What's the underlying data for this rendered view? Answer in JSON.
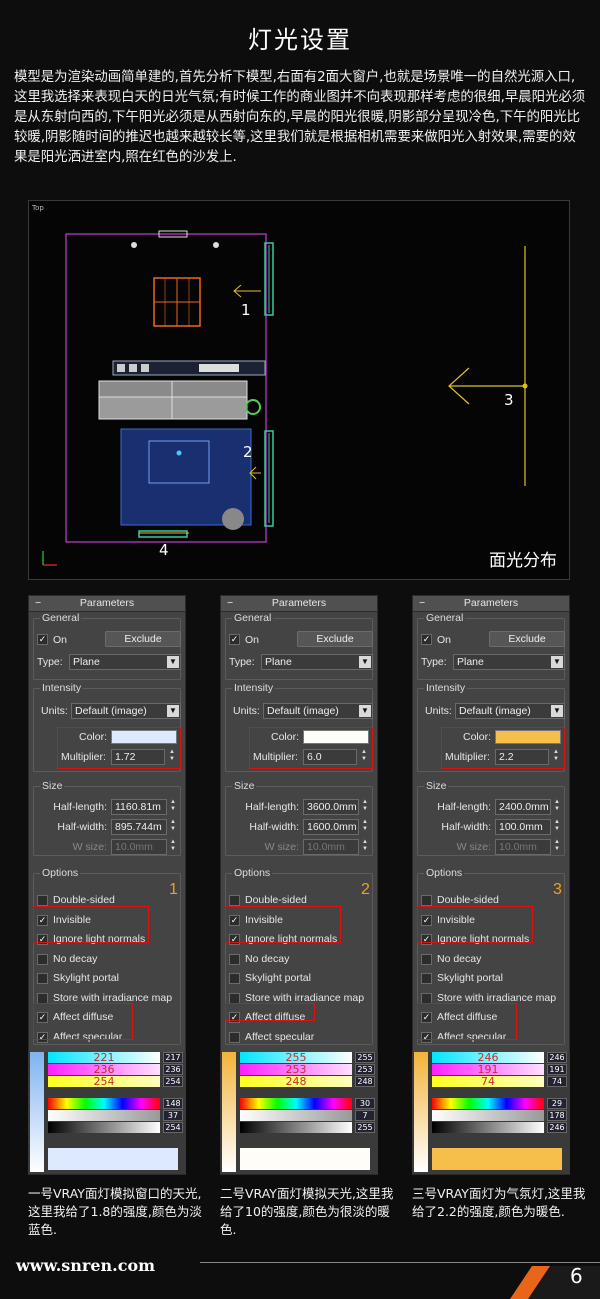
{
  "title": "灯光设置",
  "intro": "模型是为渲染动画简单建的,首先分析下模型,右面有2面大窗户,也就是场景唯一的自然光源入口,这里我选择来表现白天的日光气氛;有时候工作的商业图并不向表现那样考虑的很细,早晨阳光必须是从东射向西的,下午阳光必须是从西射向东的,早晨的阳光很暖,阴影部分呈现冷色,下午的阳光比较暖,阴影随时间的推迟也越来越较长等,这里我们就是根据相机需要来做阳光入射效果,需要的效果是阳光洒进室内,照在红色的沙发上.",
  "viewport": {
    "label": "Top",
    "caption": "面光分布",
    "markers": [
      "1",
      "2",
      "3",
      "4"
    ]
  },
  "panels": [
    {
      "header": "Parameters",
      "general_label": "General",
      "on_label": "On",
      "exclude_label": "Exclude",
      "type_label": "Type:",
      "type_value": "Plane",
      "intensity_label": "Intensity",
      "units_label": "Units:",
      "units_value": "Default (image)",
      "color_label": "Color:",
      "color_value": "#dce9ff",
      "multiplier_label": "Multiplier:",
      "multiplier_value": "1.72",
      "size_label": "Size",
      "half_length_label": "Half-length:",
      "half_length_value": "1160.81m",
      "half_width_label": "Half-width:",
      "half_width_value": "895.744m",
      "wsize_label": "W size:",
      "wsize_value": "10.0mm",
      "options_label": "Options",
      "badge": "1",
      "options": [
        {
          "label": "Double-sided",
          "checked": false
        },
        {
          "label": "Invisible",
          "checked": true
        },
        {
          "label": "Ignore light normals",
          "checked": true
        },
        {
          "label": "No decay",
          "checked": false
        },
        {
          "label": "Skylight portal",
          "checked": false
        },
        {
          "label": "Store with irradiance map",
          "checked": false
        },
        {
          "label": "Affect diffuse",
          "checked": true
        },
        {
          "label": "Affect specular",
          "checked": true
        }
      ],
      "picker": {
        "rgb": [
          "221",
          "236",
          "254"
        ],
        "rgb_side": [
          "217",
          "236",
          "254"
        ],
        "hsv_side": [
          "148",
          "37",
          "254"
        ],
        "preview": "#dce9ff",
        "bar_color": "#7fb3f0"
      },
      "caption": "一号VRAY面灯模拟窗口的天光,这里我给了1.8的强度,颜色为淡蓝色."
    },
    {
      "header": "Parameters",
      "general_label": "General",
      "on_label": "On",
      "exclude_label": "Exclude",
      "type_label": "Type:",
      "type_value": "Plane",
      "intensity_label": "Intensity",
      "units_label": "Units:",
      "units_value": "Default (image)",
      "color_label": "Color:",
      "color_value": "#fffdf8",
      "multiplier_label": "Multiplier:",
      "multiplier_value": "6.0",
      "size_label": "Size",
      "half_length_label": "Half-length:",
      "half_length_value": "3600.0mm",
      "half_width_label": "Half-width:",
      "half_width_value": "1600.0mm",
      "wsize_label": "W size:",
      "wsize_value": "10.0mm",
      "options_label": "Options",
      "badge": "2",
      "options": [
        {
          "label": "Double-sided",
          "checked": false
        },
        {
          "label": "Invisible",
          "checked": true
        },
        {
          "label": "Ignore light normals",
          "checked": true
        },
        {
          "label": "No decay",
          "checked": false
        },
        {
          "label": "Skylight portal",
          "checked": false
        },
        {
          "label": "Store with irradiance map",
          "checked": false
        },
        {
          "label": "Affect diffuse",
          "checked": true
        },
        {
          "label": "Affect specular",
          "checked": false
        }
      ],
      "picker": {
        "rgb": [
          "255",
          "253",
          "248"
        ],
        "rgb_side": [
          "255",
          "253",
          "248"
        ],
        "hsv_side": [
          "30",
          "7",
          "255"
        ],
        "preview": "#fffdf8",
        "bar_color": "#f2b33a"
      },
      "caption": "二号VRAY面灯模拟天光,这里我给了10的强度,颜色为很淡的暖色."
    },
    {
      "header": "Parameters",
      "general_label": "General",
      "on_label": "On",
      "exclude_label": "Exclude",
      "type_label": "Type:",
      "type_value": "Plane",
      "intensity_label": "Intensity",
      "units_label": "Units:",
      "units_value": "Default (image)",
      "color_label": "Color:",
      "color_value": "#f6bf4a",
      "multiplier_label": "Multiplier:",
      "multiplier_value": "2.2",
      "size_label": "Size",
      "half_length_label": "Half-length:",
      "half_length_value": "2400.0mm",
      "half_width_label": "Half-width:",
      "half_width_value": "100.0mm",
      "wsize_label": "W size:",
      "wsize_value": "10.0mm",
      "options_label": "Options",
      "badge": "3",
      "options": [
        {
          "label": "Double-sided",
          "checked": false
        },
        {
          "label": "Invisible",
          "checked": true
        },
        {
          "label": "Ignore light normals",
          "checked": true
        },
        {
          "label": "No decay",
          "checked": false
        },
        {
          "label": "Skylight portal",
          "checked": false
        },
        {
          "label": "Store with irradiance map",
          "checked": false
        },
        {
          "label": "Affect diffuse",
          "checked": true
        },
        {
          "label": "Affect specular",
          "checked": true
        }
      ],
      "picker": {
        "rgb": [
          "246",
          "191",
          "74"
        ],
        "rgb_side": [
          "246",
          "191",
          "74"
        ],
        "hsv_side": [
          "29",
          "178",
          "246"
        ],
        "preview": "#f6bf4a",
        "bar_color": "#f2b33a"
      },
      "caption": "三号VRAY面灯为气氛灯,这里我给了2.2的强度,颜色为暖色."
    }
  ],
  "footer": {
    "url": "www.snren.com",
    "page": "6"
  }
}
